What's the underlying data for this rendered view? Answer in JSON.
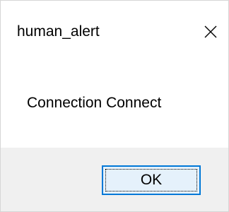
{
  "dialog": {
    "title": "human_alert",
    "close_icon": "close-icon",
    "message": "Connection Connect",
    "ok_label": "OK"
  },
  "colors": {
    "button_border": "#0078d7",
    "button_fill": "#e5f1fb",
    "footer_background": "#f0f0f0",
    "window_border": "#d6d6d6"
  }
}
